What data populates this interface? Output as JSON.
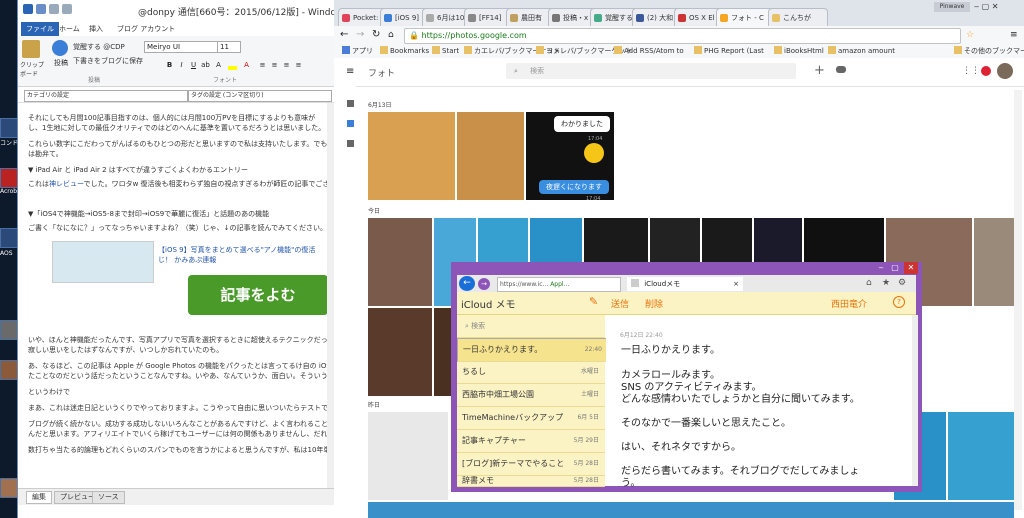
{
  "wlw": {
    "title": "@donpy 通信[660号：2015/06/12版] - Windows",
    "tabs": [
      "ファイル",
      "ホーム",
      "挿入",
      "ブログ アカウント"
    ],
    "clip_label": "クリップ ボード",
    "publish_label": "投稿",
    "preview_label": "覚醒する @CDP",
    "draft_label": "下書きをブログに保存",
    "font_name": "Meiryo UI",
    "font_size": "11",
    "group_post": "投稿",
    "group_font": "フォント",
    "category": "カテゴリの設定",
    "tags": "タグの設定 (コンマ区切り)",
    "para1": "それにしても月間100記事目指すのは、個人的には月間100万PVを目標にするよりも意味が",
    "para2": "し、1生地に対しての最低クオリティでのはどのへんに基準を置いてるだろうとは思いました。",
    "para3": "これらい数字にこだわってがんばるのもひとつの形だと思いますので私は支持いたします。でも最後",
    "para4": "は勘弁て。",
    "entry1": "▼ iPad Air と iPad Air 2 はすべてが違うすごくよくわかるエントリー",
    "entry1b": "これは",
    "entry1b_link": "神レビュー",
    "entry1b_rest": "でした。ワロタw 復活後も相変わらず独自の視点すぎるわが師匠の記事でござい",
    "entry2": "▼「iOS4で神機能→iOS5-8まで封印→iOS9で華麗に復活」と話題のあの機能",
    "entry2b": "ご書く「なになに？」ってなっちゃいますよね？（笑）じゃ、↓の記事を読んでみてください。",
    "banner_link": "【iOS 9】写真をまとめて選べる\"アノ機能\"の復活",
    "banner_link2": "じ！ かみあぷ連報",
    "banner_btn": "記事をよむ",
    "para5": "いや、ほんと神機能だったんです、写真アプリで写真を選択するときに超使えるテクニックだったんで",
    "para6": "寂しい思いをしたはずなんですが、いつしか忘れていたのも。",
    "para7": "あ、なるほど、この記事は Apple が Google Photos の機能をパクったとは言ってるけ自の iOS",
    "para8": "たことなのだという話だったということなんですね。いやあ、なんていうか、面白い。そういうのを切磋琢",
    "para9": "というわけで",
    "para10": "まあ、これは迷走日記というくりでやっておりますよ。こうやって自由に思いついたらテストできる場所的",
    "para11": "ブログが続く続かない。成功する成功しないいろんなことがあるんですけど、よく言われることですがや",
    "para12": "んだと思います。アフィリエイトでいくら稼げてもユーザーには何の関係もありませんし、だれの得にもな",
    "para13": "数打ちゃ当たる的論理もどれくらいのスパンでものを言うかによると思うんですが、私は10年単位が目",
    "btabs": [
      "編集",
      "プレビュー",
      "ソース"
    ]
  },
  "chrome": {
    "tabs": [
      "Pocket:",
      "[iOS 9]",
      "6月は10",
      "[FF14]",
      "農田有",
      "投稿・x",
      "覚醒する",
      "(2) 大和",
      "OS X El",
      "フォト - C",
      "こんちが"
    ],
    "url": "https://photos.google.com",
    "bookmarks": [
      "アプリ",
      "Bookmarks",
      "Start",
      "カエレバ/ブックマーケット",
      "ヨメレバ/ブックマーケット",
      "Add RSS/Atom to",
      "PHG Report (Last",
      "iBooksHtml",
      "amazon amount",
      "その他のブックマーク"
    ],
    "window_user": "Pinwave"
  },
  "photos": {
    "title": "フォト",
    "search_placeholder": "検索",
    "date1": "6月13日",
    "date2": "今日",
    "date3": "昨日",
    "chat_text1": "わかりました",
    "chat_time1": "17:04",
    "chat_text2": "夜遅くになります",
    "chat_time2": "17:04"
  },
  "ie": {
    "url": "https://www.ic...",
    "apple_tag": "Appl...",
    "tab_title": "iCloudメモ",
    "app_title": "iCloud メモ",
    "send": "送信",
    "delete": "削除",
    "user": "西田竜介",
    "search": "検索",
    "notes": [
      {
        "title": "一日ふりかえります。",
        "date": "22:40"
      },
      {
        "title": "ちるし",
        "date": "水曜日"
      },
      {
        "title": "西脇市中畑工場公園",
        "date": "土曜日"
      },
      {
        "title": "TimeMachineバックアップ",
        "date": "6月 5日"
      },
      {
        "title": "記事キャプチャー",
        "date": "5月 29日"
      },
      {
        "title": "[ブログ]新テーマでやること",
        "date": "5月 28日"
      },
      {
        "title": "辞書メモ",
        "date": "5月 28日"
      }
    ],
    "note_date": "6月12日 22:40",
    "note_lines": [
      "一日ふりかえります。",
      "カメラロールみます。",
      "SNS のアクティビティみます。",
      "どんな感情わいたでしょうかと自分に聞いてみます。",
      "そのなかで一番楽しいと思えたこと。",
      "はい、それネタですから。",
      "だらだら書いてみます。それブログでだしてみましょ",
      "う。"
    ]
  },
  "colors": {
    "metro": "#8e55b9",
    "notes_bg": "#fbf3c4",
    "accent_orange": "#e8730a",
    "ribbon_file": "#2a64b4"
  }
}
